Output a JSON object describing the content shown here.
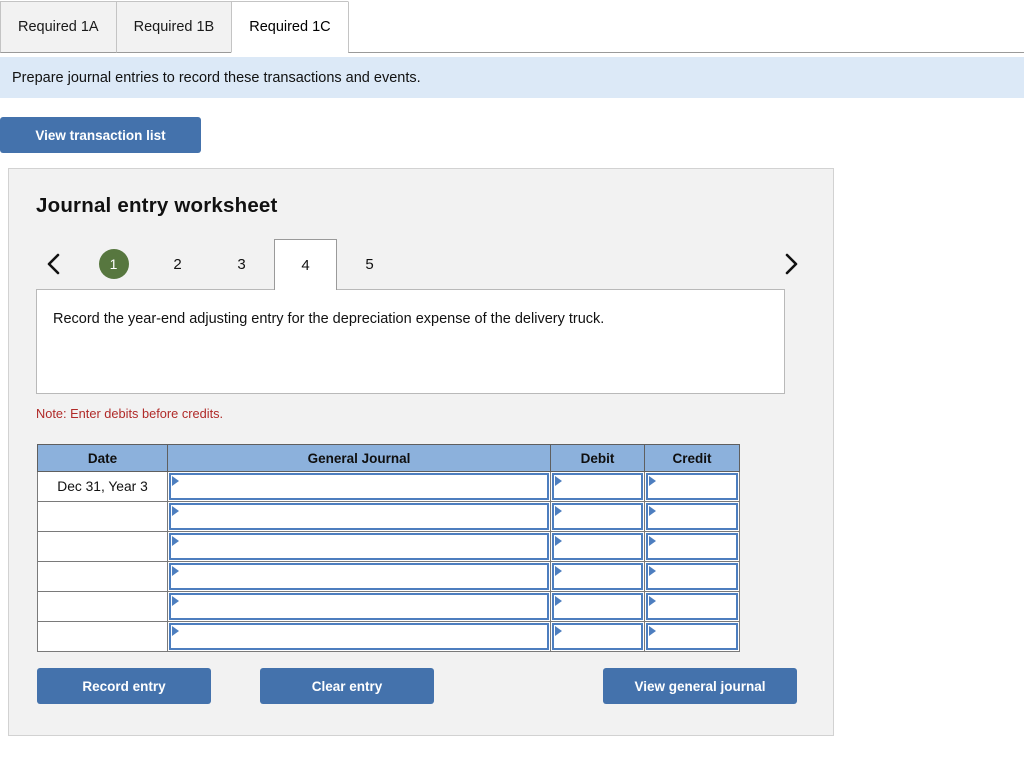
{
  "tabs": [
    {
      "label": "Required 1A",
      "active": false
    },
    {
      "label": "Required 1B",
      "active": false
    },
    {
      "label": "Required 1C",
      "active": true
    }
  ],
  "banner": {
    "text": "Prepare journal entries to record these transactions and events."
  },
  "toolbar": {
    "view_transaction_list_label": "View transaction list"
  },
  "worksheet": {
    "title": "Journal entry worksheet",
    "pager": {
      "prev_icon": "chevron-left-icon",
      "next_icon": "chevron-right-icon",
      "pages": [
        {
          "label": "1",
          "state": "completed"
        },
        {
          "label": "2",
          "state": "normal"
        },
        {
          "label": "3",
          "state": "normal"
        },
        {
          "label": "4",
          "state": "active"
        },
        {
          "label": "5",
          "state": "normal"
        }
      ]
    },
    "prompt": "Record the year-end adjusting entry for the depreciation expense of the delivery truck.",
    "note": "Note: Enter debits before credits.",
    "table": {
      "headers": [
        "Date",
        "General Journal",
        "Debit",
        "Credit"
      ],
      "rows": [
        {
          "date": "Dec 31, Year 3",
          "general_journal": "",
          "debit": "",
          "credit": ""
        },
        {
          "date": "",
          "general_journal": "",
          "debit": "",
          "credit": ""
        },
        {
          "date": "",
          "general_journal": "",
          "debit": "",
          "credit": ""
        },
        {
          "date": "",
          "general_journal": "",
          "debit": "",
          "credit": ""
        },
        {
          "date": "",
          "general_journal": "",
          "debit": "",
          "credit": ""
        },
        {
          "date": "",
          "general_journal": "",
          "debit": "",
          "credit": ""
        }
      ]
    },
    "actions": {
      "record_entry_label": "Record entry",
      "clear_entry_label": "Clear entry",
      "view_general_journal_label": "View general journal"
    }
  },
  "colors": {
    "button_blue": "#4472ac",
    "banner_blue": "#dce9f7",
    "table_header_blue": "#8cb1dc",
    "badge_green": "#57773f",
    "note_red": "#b02a28",
    "input_border_blue": "#4d7ebf"
  }
}
